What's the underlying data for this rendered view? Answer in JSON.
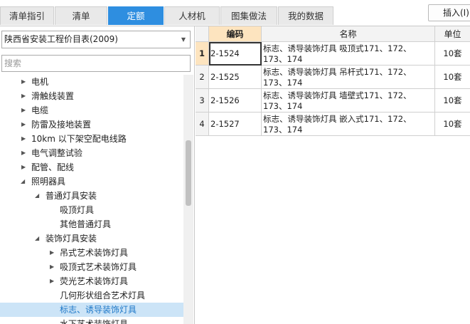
{
  "tabs": [
    {
      "label": "清单指引",
      "active": false
    },
    {
      "label": "清单",
      "active": false
    },
    {
      "label": "定额",
      "active": true
    },
    {
      "label": "人材机",
      "active": false
    },
    {
      "label": "图集做法",
      "active": false
    },
    {
      "label": "我的数据",
      "active": false
    }
  ],
  "insert_button": "插入(I)",
  "library_select": {
    "value": "陕西省安装工程价目表(2009)"
  },
  "search": {
    "placeholder": "搜索"
  },
  "tree": [
    {
      "label": "电机",
      "level": 1,
      "toggle": "collapsed"
    },
    {
      "label": "滑触线装置",
      "level": 1,
      "toggle": "collapsed"
    },
    {
      "label": "电缆",
      "level": 1,
      "toggle": "collapsed"
    },
    {
      "label": "防雷及接地装置",
      "level": 1,
      "toggle": "collapsed"
    },
    {
      "label": "10km 以下架空配电线路",
      "level": 1,
      "toggle": "collapsed"
    },
    {
      "label": "电气调整试验",
      "level": 1,
      "toggle": "collapsed"
    },
    {
      "label": "配管、配线",
      "level": 1,
      "toggle": "collapsed"
    },
    {
      "label": "照明器具",
      "level": 1,
      "toggle": "expanded"
    },
    {
      "label": "普通灯具安装",
      "level": 2,
      "toggle": "expanded"
    },
    {
      "label": "吸顶灯具",
      "level": 3,
      "toggle": "none"
    },
    {
      "label": "其他普通灯具",
      "level": 3,
      "toggle": "none"
    },
    {
      "label": "装饰灯具安装",
      "level": 2,
      "toggle": "expanded"
    },
    {
      "label": "吊式艺术装饰灯具",
      "level": 3,
      "toggle": "collapsed"
    },
    {
      "label": "吸顶式艺术装饰灯具",
      "level": 3,
      "toggle": "collapsed"
    },
    {
      "label": "荧光艺术装饰灯具",
      "level": 3,
      "toggle": "collapsed"
    },
    {
      "label": "几何形状组合艺术灯具",
      "level": 3,
      "toggle": "none"
    },
    {
      "label": "标志、诱导装饰灯具",
      "level": 3,
      "toggle": "none",
      "selected": true
    },
    {
      "label": "水下艺术装饰灯具",
      "level": 3,
      "toggle": "none"
    }
  ],
  "table": {
    "columns": [
      "编码",
      "名称",
      "单位"
    ],
    "rows": [
      {
        "num": "1",
        "code": "2-1524",
        "name": "标志、诱导装饰灯具 吸顶式171、172、173、174",
        "unit": "10套",
        "current": true
      },
      {
        "num": "2",
        "code": "2-1525",
        "name": "标志、诱导装饰灯具 吊杆式171、172、173、174",
        "unit": "10套"
      },
      {
        "num": "3",
        "code": "2-1526",
        "name": "标志、诱导装饰灯具 墙壁式171、172、173、174",
        "unit": "10套"
      },
      {
        "num": "4",
        "code": "2-1527",
        "name": "标志、诱导装饰灯具 嵌入式171、172、173、174",
        "unit": "10套"
      }
    ]
  },
  "colors": {
    "accent": "#2e8ee0",
    "selected_row": "#cce4f7",
    "header_highlight": "#fde4bf"
  }
}
